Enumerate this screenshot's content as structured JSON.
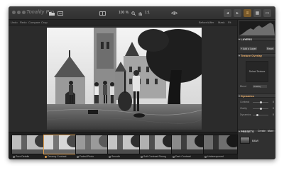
{
  "app": {
    "title": "Tonality Pro"
  },
  "toolbar": {
    "zoom": "100 %",
    "zoom_fit": "1:1"
  },
  "subbar": {
    "items": [
      "Undo",
      "Redo",
      "Compare",
      "Crop",
      "Before/After",
      "Mask",
      "Fit"
    ]
  },
  "panel": {
    "layers_title": "LAYERS",
    "add_layer_label": "+ Add a Layer",
    "reset_label": "Reset",
    "texture_section": "Texture Overlay",
    "texture_placeholder": "Select Texture",
    "blend_label": "Blend",
    "blend_value": "Overlay",
    "dynamic_section": "Dynamics",
    "sliders": [
      {
        "label": "Contrast",
        "value": "0",
        "position": 0.5
      },
      {
        "label": "Clarity",
        "value": "0",
        "position": 0.5
      },
      {
        "label": "Dynamics",
        "value": "0",
        "position": 0.3
      }
    ],
    "presets_title": "PRESETS",
    "presets_create": "Create",
    "presets_more": "More",
    "preset_current": "B&W"
  },
  "strip": {
    "thumbs": [
      {
        "label": "Pure Details",
        "selected": false
      },
      {
        "label": "Dreamy Contrast",
        "selected": true
      },
      {
        "label": "Faded Photo",
        "selected": false
      },
      {
        "label": "Smooth",
        "selected": false
      },
      {
        "label": "Soft Contrast Strong",
        "selected": false
      },
      {
        "label": "Dark Contrast",
        "selected": false
      },
      {
        "label": "Underexposed",
        "selected": false
      }
    ]
  },
  "colors": {
    "accent": "#e0a050",
    "window_bg": "#2a2a2a",
    "panel_bg": "#303030"
  }
}
